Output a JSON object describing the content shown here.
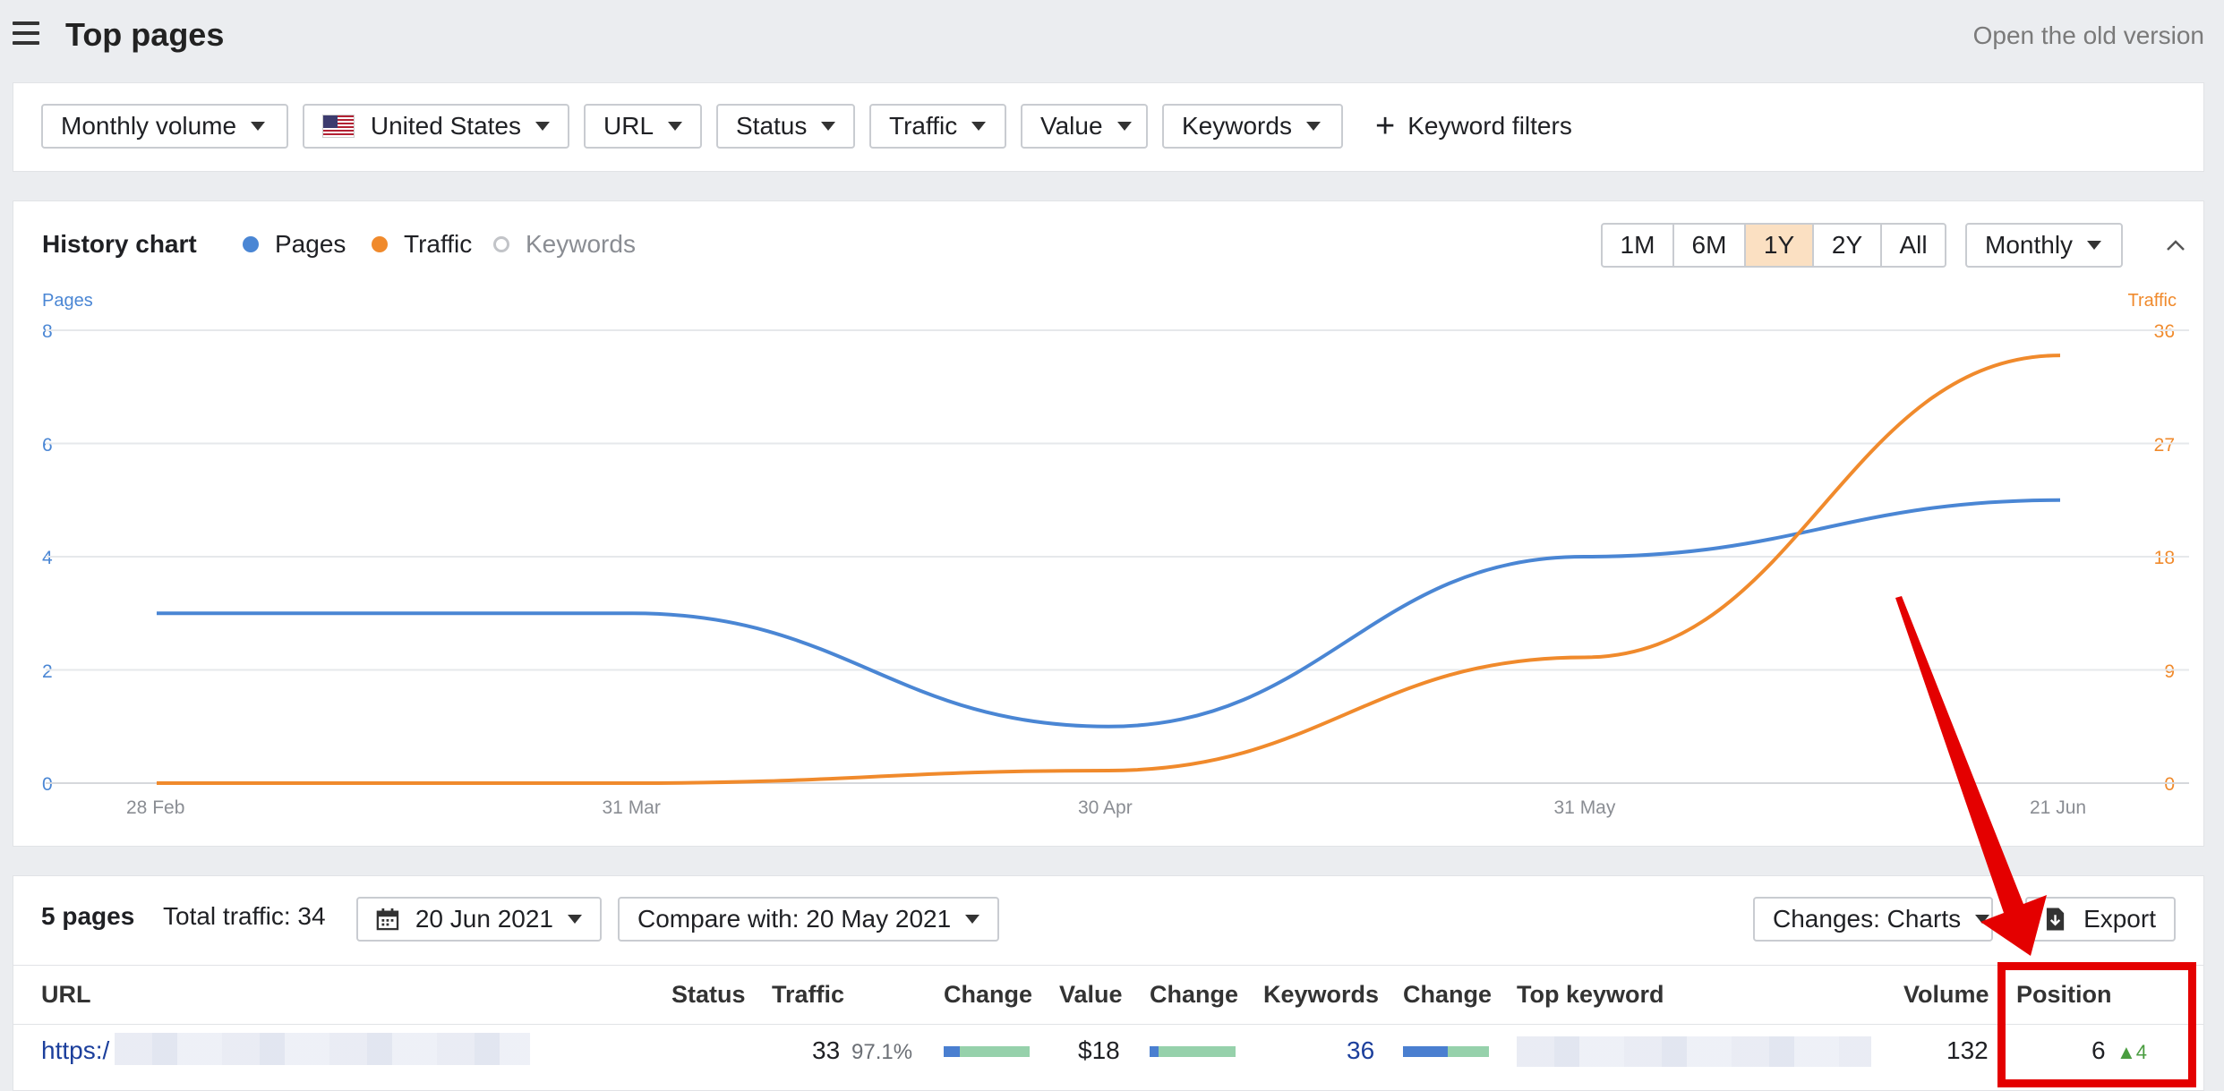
{
  "header": {
    "title": "Top pages",
    "old_version_link": "Open the old version"
  },
  "filters": {
    "monthly_volume": "Monthly volume",
    "country": "United States",
    "url": "URL",
    "status": "Status",
    "traffic": "Traffic",
    "value": "Value",
    "keywords": "Keywords",
    "keyword_filters": "Keyword filters"
  },
  "history": {
    "title": "History chart",
    "legend": [
      {
        "label": "Pages",
        "color": "#4a86d4",
        "active": true
      },
      {
        "label": "Traffic",
        "color": "#f08a2c",
        "active": true
      },
      {
        "label": "Keywords",
        "color": "#b0b0b0",
        "active": false
      }
    ],
    "ranges": [
      "1M",
      "6M",
      "1Y",
      "2Y",
      "All"
    ],
    "active_range": "1Y",
    "interval": "Monthly"
  },
  "chart_data": {
    "type": "line",
    "x": [
      "28 Feb",
      "31 Mar",
      "30 Apr",
      "31 May",
      "21 Jun"
    ],
    "x_tick_labels": [
      "28 Feb",
      "31 Mar",
      "30 Apr",
      "31 May",
      "21 Jun"
    ],
    "left_axis": {
      "label": "Pages",
      "ticks": [
        "0",
        "2",
        "4",
        "6",
        "8"
      ],
      "ylim": [
        0,
        8
      ]
    },
    "right_axis": {
      "label": "Traffic",
      "ticks": [
        "0",
        "9",
        "18",
        "27",
        "36"
      ],
      "ylim": [
        0,
        36
      ]
    },
    "series": [
      {
        "name": "Pages",
        "axis": "left",
        "color": "#4a86d4",
        "values": [
          3,
          3,
          1,
          4,
          5
        ]
      },
      {
        "name": "Traffic",
        "axis": "right",
        "color": "#f08a2c",
        "values": [
          0,
          0,
          1,
          10,
          34
        ]
      }
    ],
    "grid": true
  },
  "table": {
    "pages_count": "5 pages",
    "total_traffic": "Total traffic: 34",
    "date": "20 Jun 2021",
    "compare": "Compare with: 20 May 2021",
    "changes": "Changes: Charts",
    "export": "Export",
    "columns": {
      "url": "URL",
      "status": "Status",
      "traffic": "Traffic",
      "change1": "Change",
      "value": "Value",
      "change2": "Change",
      "keywords": "Keywords",
      "change3": "Change",
      "top_keyword": "Top keyword",
      "volume": "Volume",
      "position": "Position"
    },
    "rows": [
      {
        "url": "https:/",
        "traffic": "33",
        "traffic_share": "97.1%",
        "value": "$18",
        "keywords": "36",
        "volume": "132",
        "position": "6",
        "position_change": "▲4"
      }
    ]
  }
}
